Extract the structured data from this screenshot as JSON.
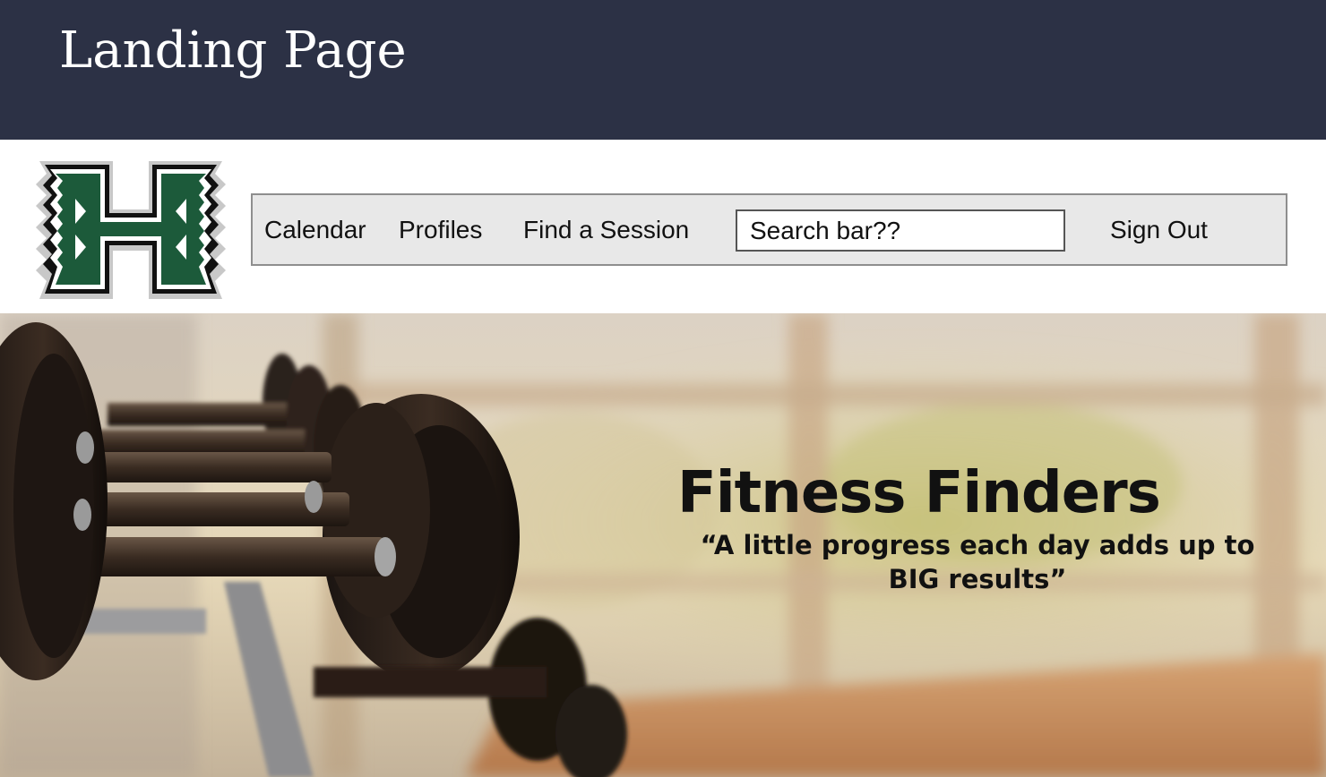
{
  "banner": {
    "title": "Landing Page",
    "background_color": "#2c3145"
  },
  "header": {
    "logo": {
      "letter": "H",
      "icon_name": "university-h-logo",
      "colors": {
        "primary": "#1c5a3a",
        "outline": "#111111",
        "shadow": "#c8c8c8"
      }
    },
    "nav": {
      "items": [
        {
          "label": "Calendar",
          "name": "nav-calendar"
        },
        {
          "label": "Profiles",
          "name": "nav-profiles"
        },
        {
          "label": "Find a Session",
          "name": "nav-find-a-session"
        }
      ],
      "search": {
        "value": "Search bar??"
      },
      "sign_out_label": "Sign Out",
      "background_color": "#e8e8e8"
    }
  },
  "hero": {
    "image": "dumbbell-rack-photo",
    "title": "Fitness Finders",
    "quote": "“A little progress each day adds up to BIG results”"
  }
}
